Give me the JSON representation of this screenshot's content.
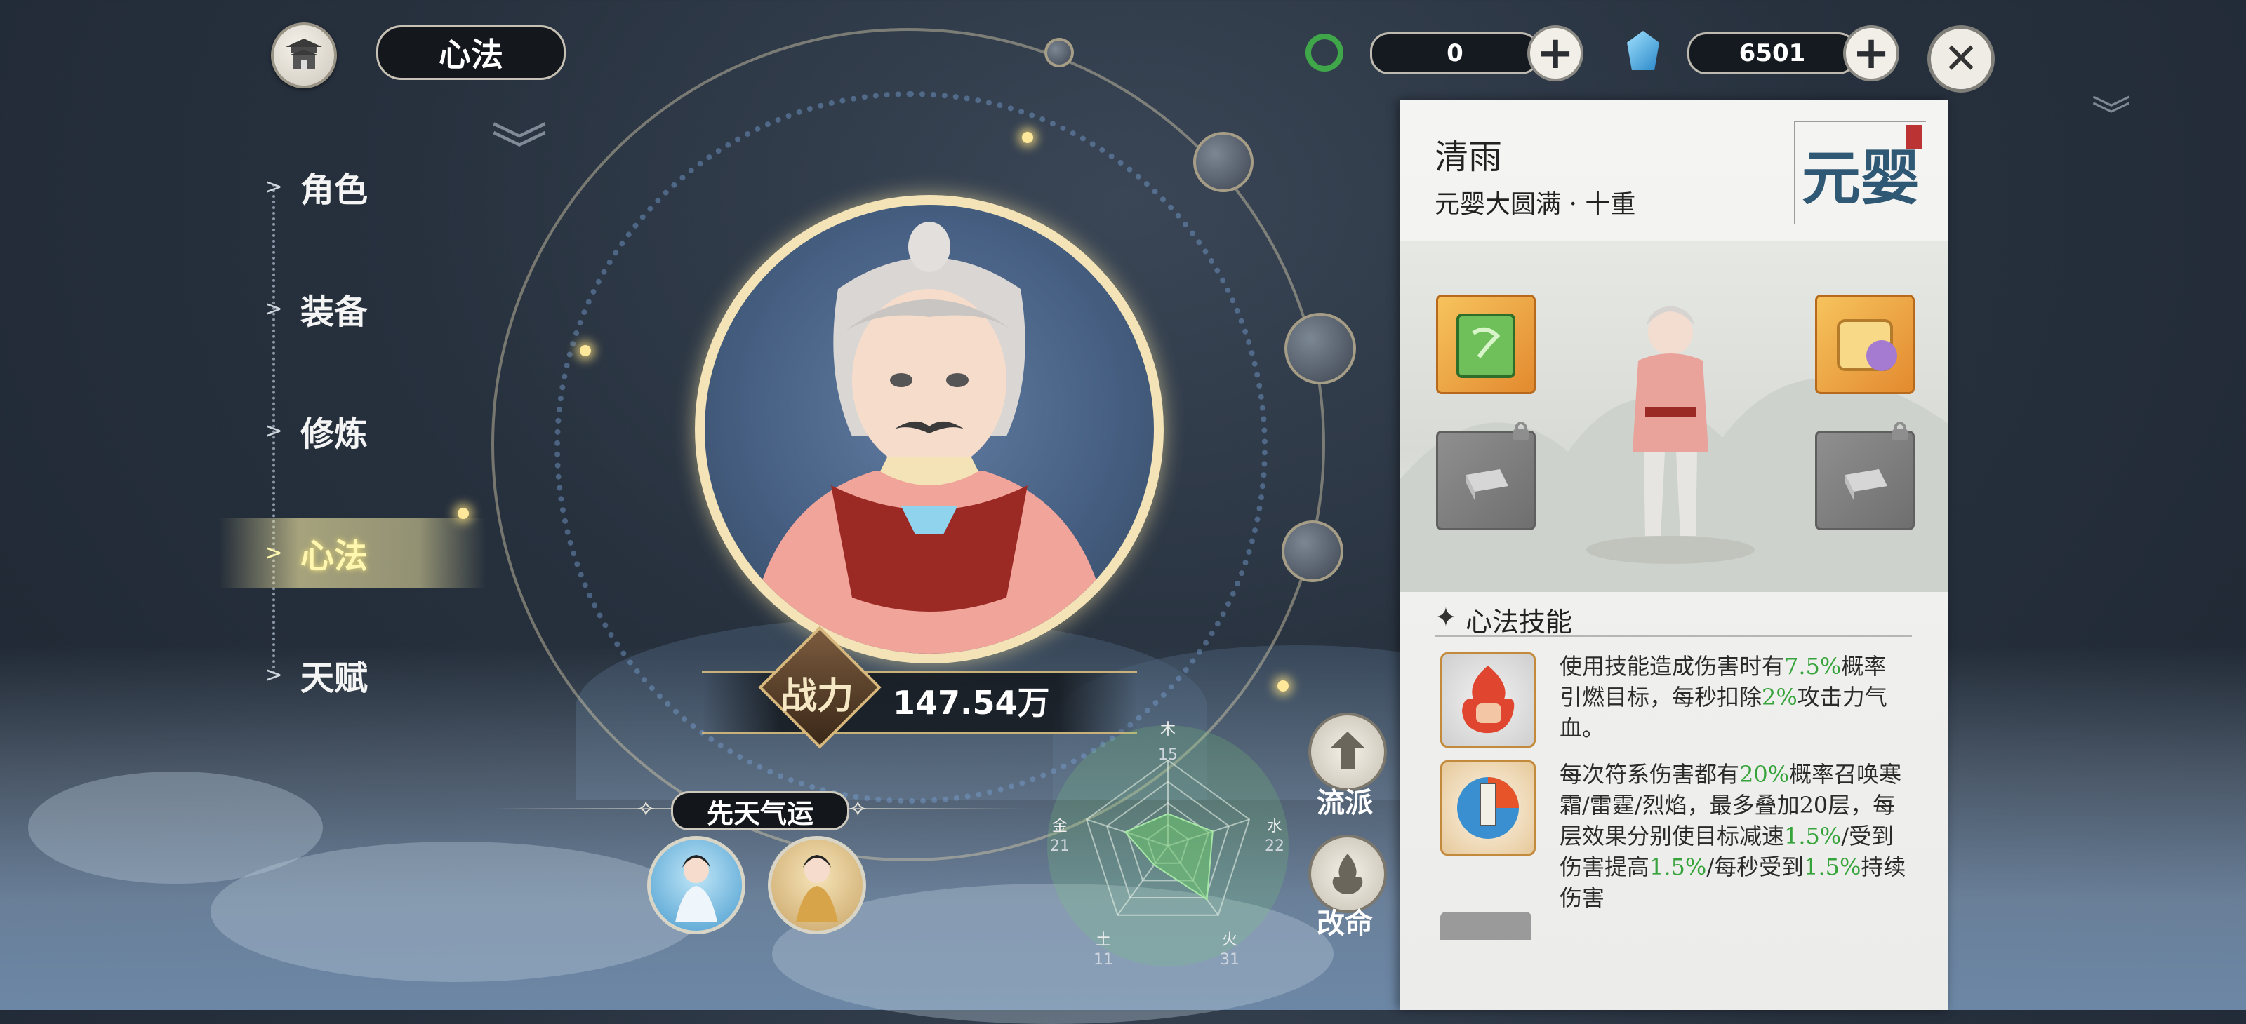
{
  "header": {
    "title": "心法",
    "currency_1": {
      "icon": "jade-swirl-icon",
      "value": "0"
    },
    "currency_2": {
      "icon": "spirit-crystal-icon",
      "value": "6501"
    }
  },
  "menu": {
    "items": [
      {
        "label": "角色",
        "active": false
      },
      {
        "label": "装备",
        "active": false
      },
      {
        "label": "修炼",
        "active": false
      },
      {
        "label": "心法",
        "active": true
      },
      {
        "label": "天赋",
        "active": false
      }
    ]
  },
  "power": {
    "label": "战力",
    "value": "147.54万"
  },
  "fortune": {
    "title": "先天气运"
  },
  "elements": {
    "wood": {
      "label": "木",
      "value": 15
    },
    "water": {
      "label": "水",
      "value": 22
    },
    "fire": {
      "label": "火",
      "value": 31
    },
    "earth": {
      "label": "土",
      "value": 11
    },
    "metal": {
      "label": "金",
      "value": 21
    }
  },
  "side_buttons": {
    "school": "流派",
    "fate": "改命"
  },
  "character": {
    "name": "清雨",
    "realm": "元婴大圆满 · 十重",
    "realm_seal": "元婴"
  },
  "skills": {
    "header": "心法技能",
    "items": [
      {
        "parts": [
          {
            "t": "使用技能造成伤害时有"
          },
          {
            "t": "7.5%",
            "hl": true
          },
          {
            "t": "概率引燃目标，每秒扣除"
          },
          {
            "t": "2%",
            "hl": true
          },
          {
            "t": "攻击力气血。"
          }
        ]
      },
      {
        "parts": [
          {
            "t": "每次符系伤害都有"
          },
          {
            "t": "20%",
            "hl": true
          },
          {
            "t": "概率召唤寒霜/雷霆/烈焰，最多叠加20层，每层效果分别使目标减速"
          },
          {
            "t": "1.5%",
            "hl": true
          },
          {
            "t": "/受到伤害提高"
          },
          {
            "t": "1.5%",
            "hl": true
          },
          {
            "t": "/每秒受到"
          },
          {
            "t": "1.5%",
            "hl": true
          },
          {
            "t": "持续伤害"
          }
        ]
      }
    ]
  },
  "colors": {
    "highlight": "#36a33b",
    "active_menu": "#fff7b0",
    "panel_bg": "#f4f4f2"
  }
}
